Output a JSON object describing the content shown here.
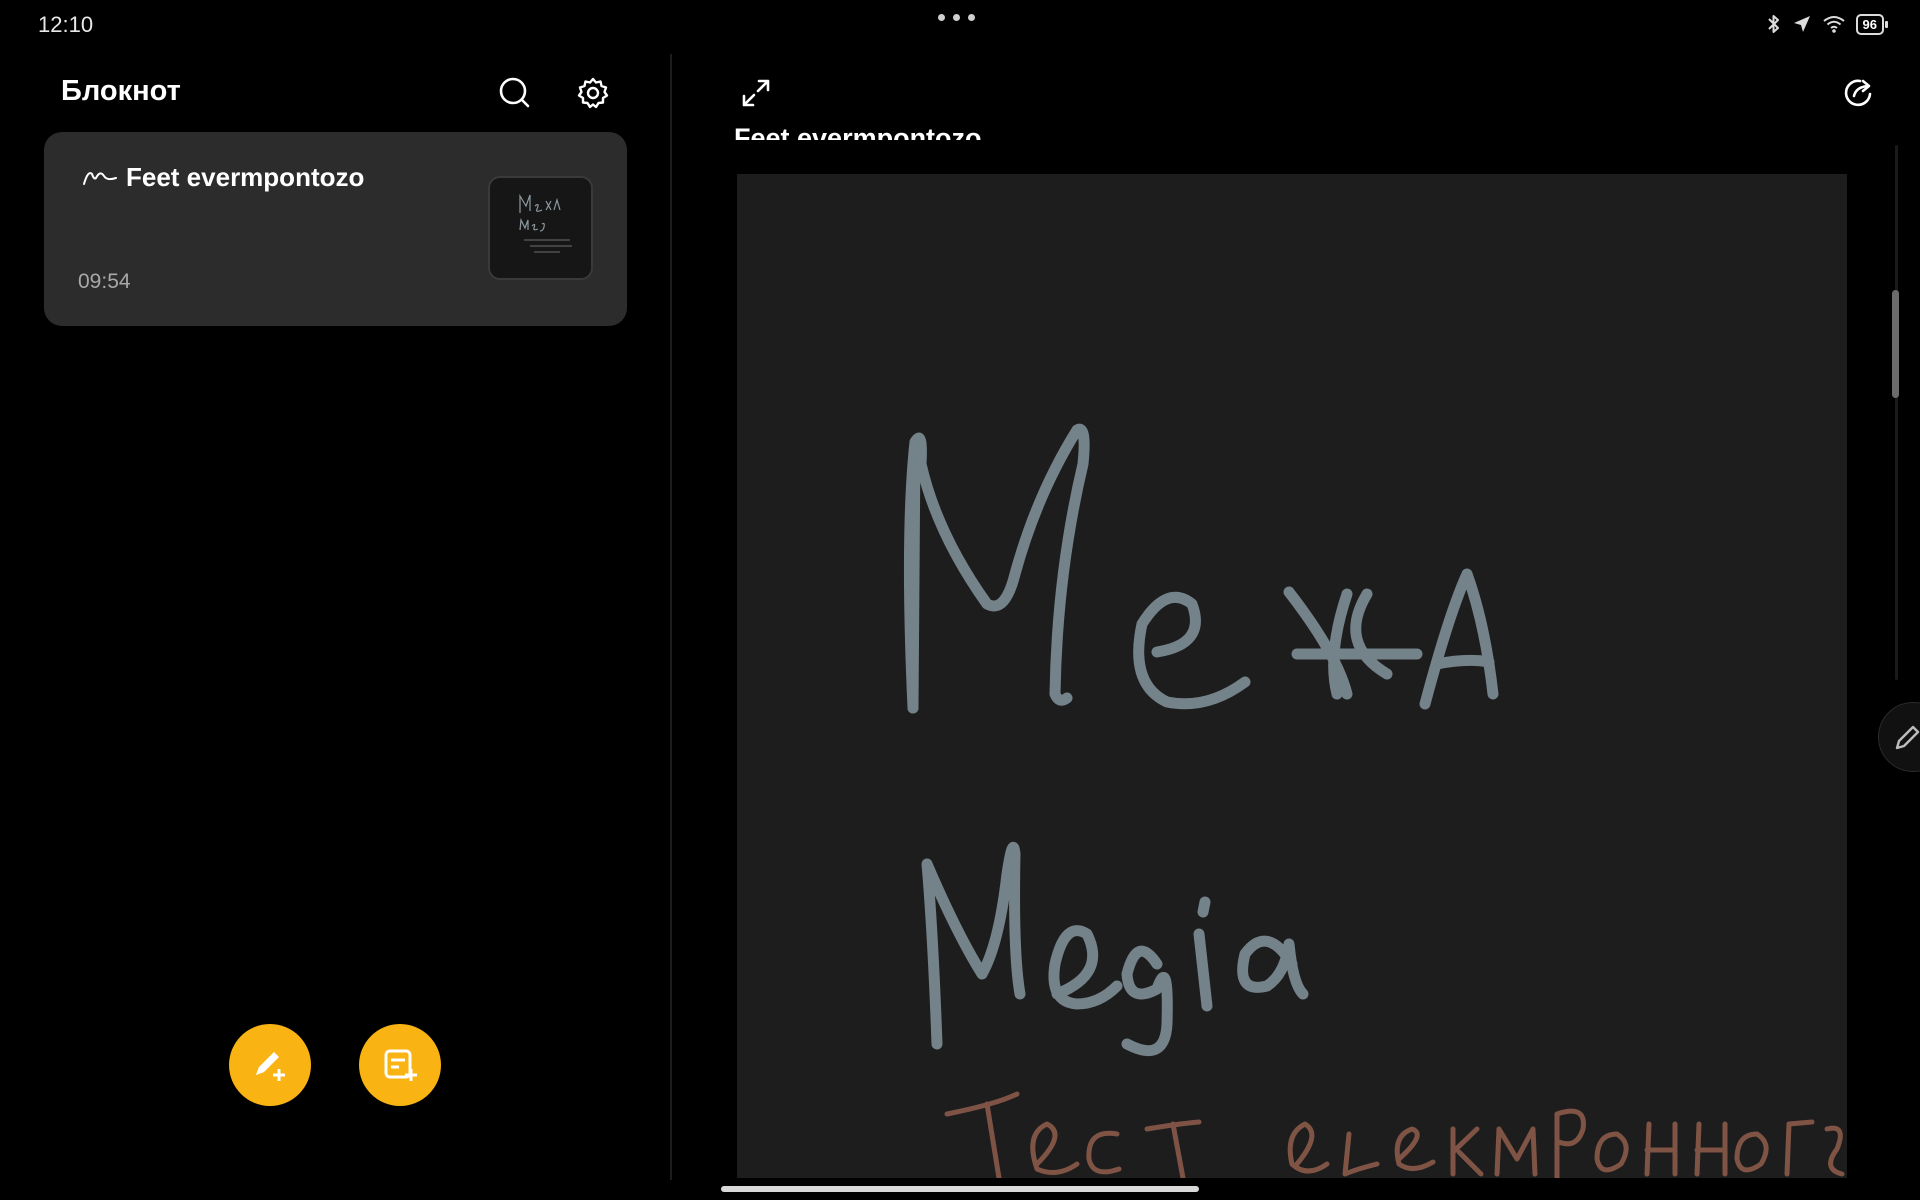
{
  "status_bar": {
    "time": "12:10",
    "battery": "96"
  },
  "sidebar": {
    "title": "Блокнот"
  },
  "notes": [
    {
      "title": "Feet evermpontozo",
      "time": "09:54"
    }
  ],
  "document": {
    "title": "Feet evermpontozo"
  },
  "colors": {
    "background": "#000000",
    "card": "#2c2c2c",
    "canvas": "#1d1d1d",
    "accent": "#f9b312",
    "ink_primary": "#7c8b93",
    "ink_secondary": "#8a5a4a"
  },
  "icons": {
    "search": "search-icon",
    "settings": "gear-icon",
    "expand": "expand-icon",
    "share": "share-icon",
    "new_handwriting": "pen-plus-icon",
    "new_text": "note-plus-icon",
    "handwriting_note": "squiggle-icon"
  }
}
